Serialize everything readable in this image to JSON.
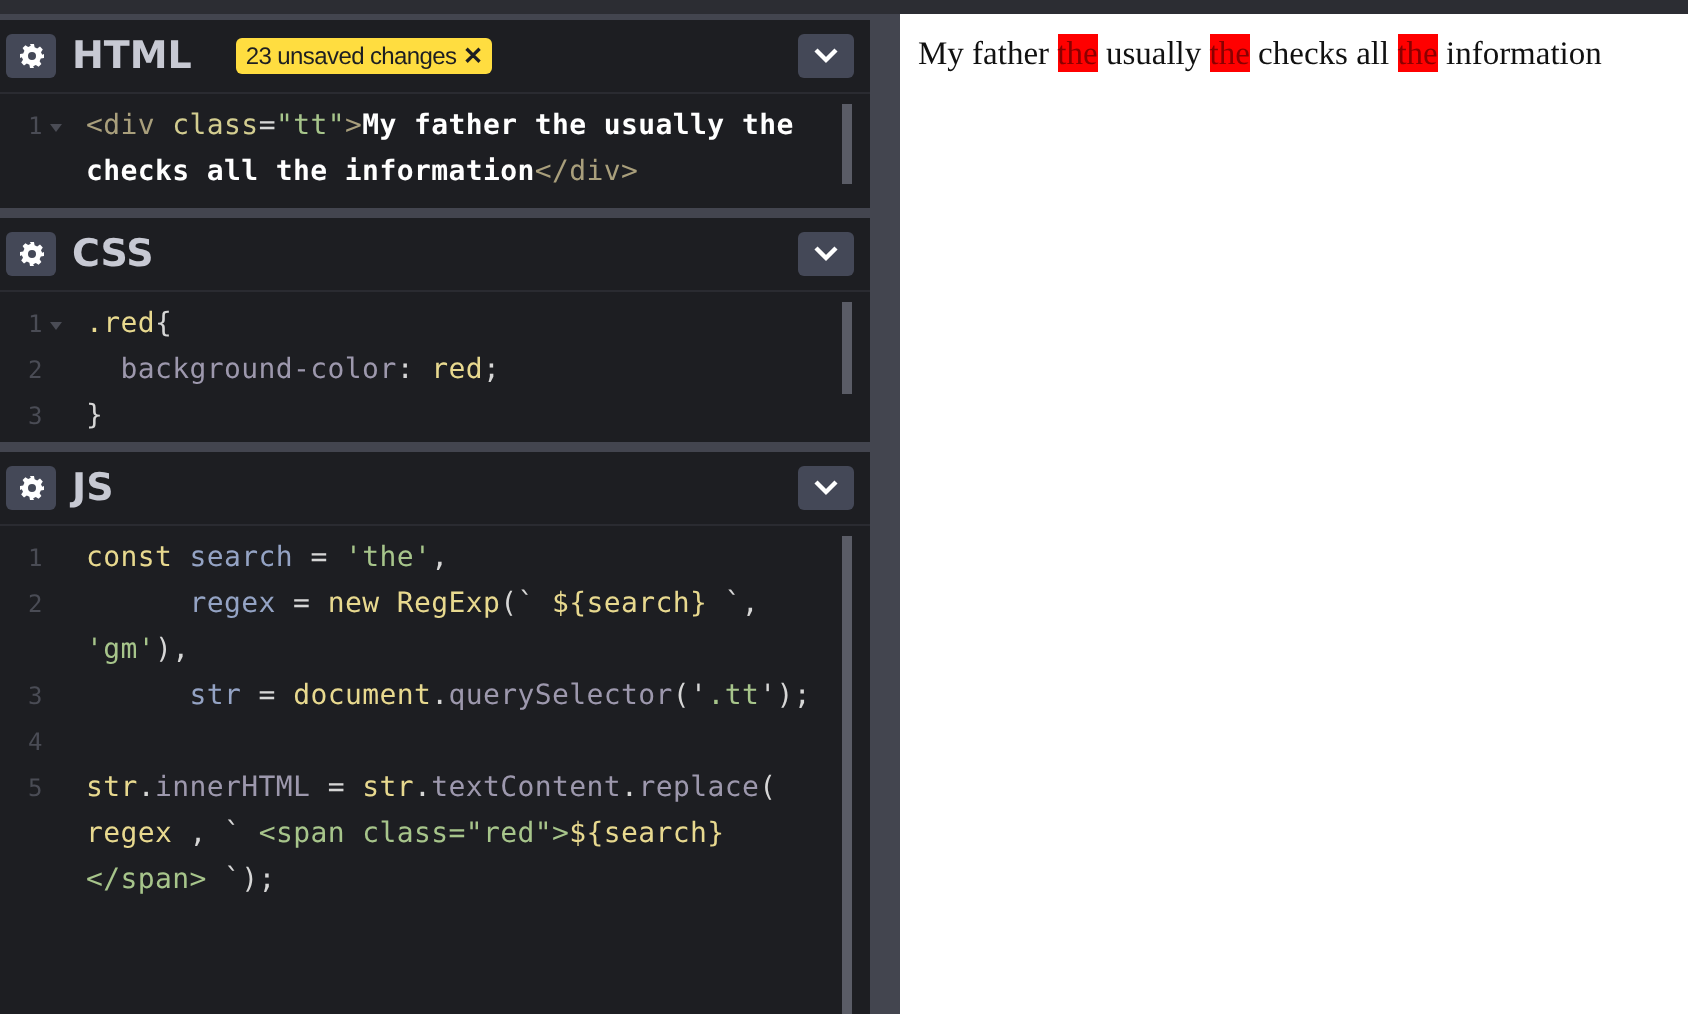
{
  "editors": [
    {
      "title": "HTML",
      "badge": {
        "text": "23 unsaved changes",
        "close": "✕"
      },
      "lines": [
        {
          "number": "1",
          "fold": true,
          "tokens": [
            {
              "kind": "tag",
              "text": "<div "
            },
            {
              "kind": "attr",
              "text": "class"
            },
            {
              "kind": "punct",
              "text": "="
            },
            {
              "kind": "string",
              "text": "\"tt\""
            },
            {
              "kind": "tag",
              "text": ">"
            },
            {
              "kind": "text",
              "text": "My father the usually the"
            }
          ]
        },
        {
          "tokens": [
            {
              "kind": "text",
              "text": "checks all the information"
            },
            {
              "kind": "tag",
              "text": "</div>"
            }
          ]
        }
      ]
    },
    {
      "title": "CSS",
      "lines": [
        {
          "number": "1",
          "fold": true,
          "tokens": [
            {
              "kind": "keyword",
              "text": ".red"
            },
            {
              "kind": "punct",
              "text": "{"
            }
          ]
        },
        {
          "number": "2",
          "fold": false,
          "tokens": [
            {
              "kind": "property",
              "text": "  background-color"
            },
            {
              "kind": "punct",
              "text": ": "
            },
            {
              "kind": "keyword",
              "text": "red"
            },
            {
              "kind": "punct",
              "text": ";"
            }
          ]
        },
        {
          "number": "3",
          "fold": false,
          "tokens": [
            {
              "kind": "punct",
              "text": "}"
            }
          ]
        }
      ]
    },
    {
      "title": "JS",
      "lines": [
        {
          "number": "1",
          "fold": false,
          "tokens": [
            {
              "kind": "keyword",
              "text": "const "
            },
            {
              "kind": "variable",
              "text": "search"
            },
            {
              "kind": "punct",
              "text": " = "
            },
            {
              "kind": "string",
              "text": "'the'"
            },
            {
              "kind": "punct",
              "text": ","
            }
          ]
        },
        {
          "number": "2",
          "fold": false,
          "tokens": [
            {
              "kind": "variable",
              "text": "      regex"
            },
            {
              "kind": "punct",
              "text": " = "
            },
            {
              "kind": "keyword",
              "text": "new RegExp"
            },
            {
              "kind": "punct",
              "text": "(` "
            },
            {
              "kind": "keyword",
              "text": "${search}"
            },
            {
              "kind": "punct",
              "text": " `,"
            }
          ]
        },
        {
          "tokens": [
            {
              "kind": "string",
              "text": "'gm'"
            },
            {
              "kind": "punct",
              "text": "),"
            }
          ]
        },
        {
          "number": "3",
          "fold": false,
          "tokens": [
            {
              "kind": "variable",
              "text": "      str"
            },
            {
              "kind": "punct",
              "text": " = "
            },
            {
              "kind": "keyword",
              "text": "document"
            },
            {
              "kind": "punct",
              "text": "."
            },
            {
              "kind": "property",
              "text": "querySelector"
            },
            {
              "kind": "punct",
              "text": "('"
            },
            {
              "kind": "string",
              "text": ".tt"
            },
            {
              "kind": "punct",
              "text": "');"
            }
          ]
        },
        {
          "number": "4",
          "fold": false
        },
        {
          "number": "5",
          "fold": false,
          "tokens": [
            {
              "kind": "keyword",
              "text": "str"
            },
            {
              "kind": "punct",
              "text": "."
            },
            {
              "kind": "property",
              "text": "innerHTML"
            },
            {
              "kind": "punct",
              "text": " = "
            },
            {
              "kind": "keyword",
              "text": "str"
            },
            {
              "kind": "punct",
              "text": "."
            },
            {
              "kind": "property",
              "text": "textContent"
            },
            {
              "kind": "punct",
              "text": "."
            },
            {
              "kind": "property",
              "text": "replace"
            },
            {
              "kind": "punct",
              "text": "("
            }
          ]
        },
        {
          "tokens": [
            {
              "kind": "keyword",
              "text": "regex"
            },
            {
              "kind": "punct",
              "text": " , ` "
            },
            {
              "kind": "string",
              "text": "<span class=\"red\">"
            },
            {
              "kind": "keyword",
              "text": "${search}"
            }
          ]
        },
        {
          "tokens": [
            {
              "kind": "string",
              "text": "</span>"
            },
            {
              "kind": "punct",
              "text": " `);"
            }
          ]
        }
      ]
    }
  ],
  "output": {
    "segments": [
      {
        "text": "My father",
        "highlighted": false
      },
      {
        "text": "the",
        "highlighted": true
      },
      {
        "text": "usually",
        "highlighted": false
      },
      {
        "text": "the",
        "highlighted": true
      },
      {
        "text": "checks all",
        "highlighted": false
      },
      {
        "text": "the",
        "highlighted": true
      },
      {
        "text": "information",
        "highlighted": false
      }
    ]
  }
}
